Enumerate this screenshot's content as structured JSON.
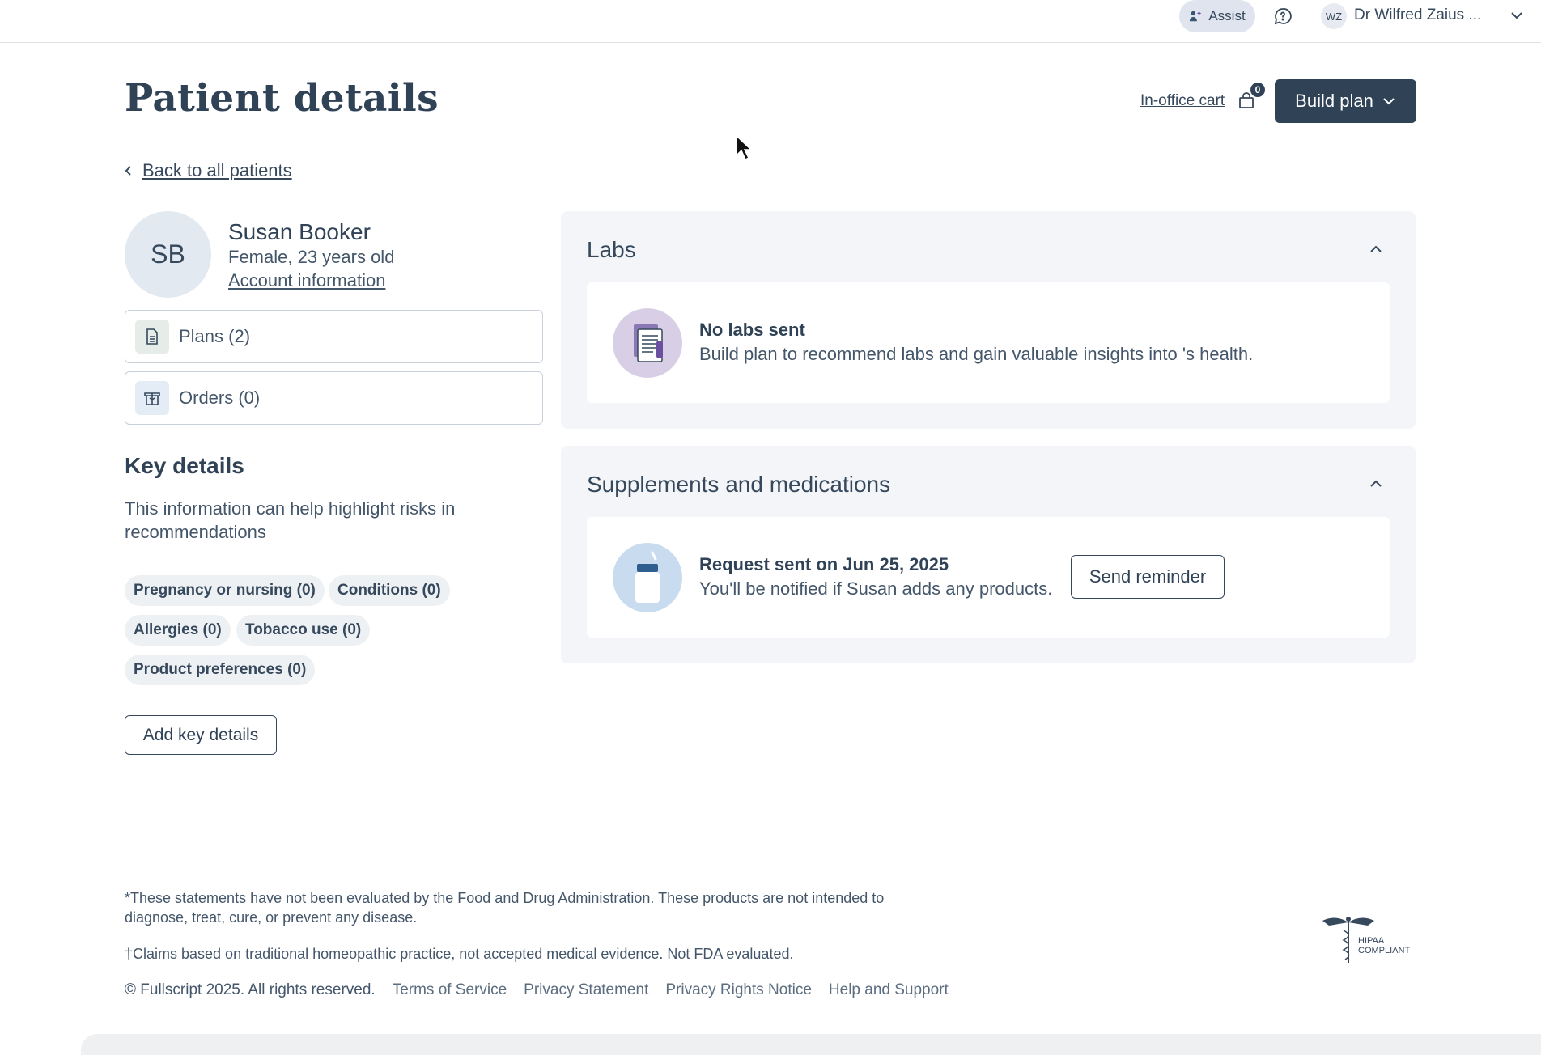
{
  "topbar": {
    "assist_label": "Assist",
    "user_initials": "WZ",
    "user_name": "Dr Wilfred Zaius ..."
  },
  "header": {
    "title": "Patient details",
    "cart_label": "In-office cart",
    "cart_count": "0",
    "build_plan_label": "Build plan"
  },
  "back_link": "Back to all patients",
  "patient": {
    "initials": "SB",
    "name": "Susan Booker",
    "info": "Female, 23 years old",
    "account_link": "Account information"
  },
  "nav_cards": {
    "plans": "Plans (2)",
    "orders": "Orders (0)"
  },
  "key_details": {
    "title": "Key details",
    "description": "This information can help highlight risks in recommendations",
    "chips": {
      "pregnancy": "Pregnancy or nursing (0)",
      "conditions": "Conditions (0)",
      "allergies": "Allergies (0)",
      "tobacco": "Tobacco use (0)",
      "preferences": "Product preferences (0)"
    },
    "add_button": "Add key details"
  },
  "labs": {
    "title": "Labs",
    "heading": "No labs sent",
    "text": "Build plan to recommend labs and gain valuable insights into 's health."
  },
  "supplements": {
    "title": "Supplements and medications",
    "heading": "Request sent on Jun 25, 2025",
    "text": "You'll be notified if Susan adds any products.",
    "remind_button": "Send reminder"
  },
  "footer": {
    "disclaimer": "*These statements have not been evaluated by the Food and Drug Administration. These products are not intended to diagnose, treat, cure, or prevent any disease.",
    "homeopathic": "†Claims based on traditional homeopathic practice, not accepted medical evidence. Not FDA evaluated.",
    "copyright": "© Fullscript 2025. All rights reserved.",
    "links": {
      "terms": "Terms of Service",
      "privacy": "Privacy Statement",
      "rights": "Privacy Rights Notice",
      "help": "Help and Support"
    },
    "hipaa": "HIPAA COMPLIANT"
  },
  "colors": {
    "primary": "#2f4256",
    "panel_bg": "#f3f5f8",
    "labs_circle": "#d8cfe6",
    "supp_circle": "#c9dcef"
  }
}
